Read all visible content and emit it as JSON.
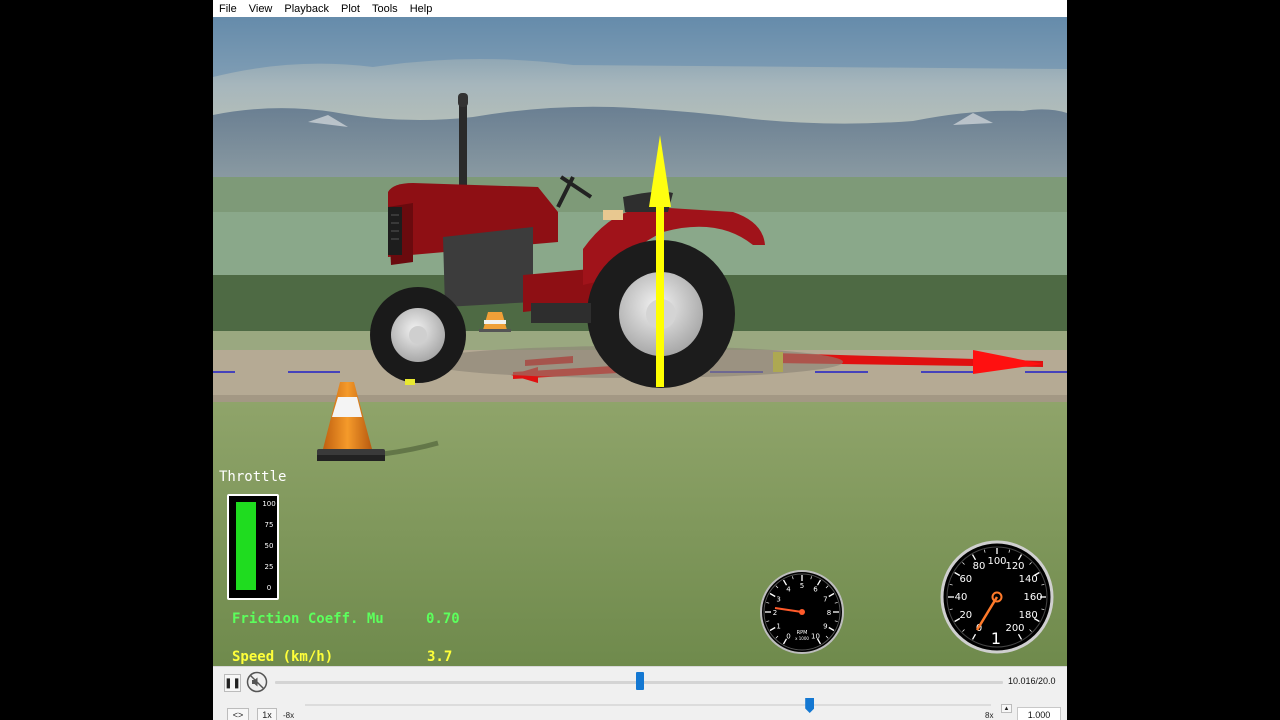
{
  "menu": {
    "items": [
      "File",
      "View",
      "Playback",
      "Plot",
      "Tools",
      "Help"
    ]
  },
  "hud": {
    "throttle": {
      "title": "Throttle",
      "ticks": [
        "100",
        "75",
        "50",
        "25",
        "0"
      ],
      "level_percent": 100,
      "fill_color": "#1fdc1f"
    },
    "friction": {
      "label": "Friction Coeff. Mu",
      "value": "0.70",
      "color": "#5cff5c"
    },
    "speed": {
      "label": "Speed (km/h)",
      "value": "3.7",
      "color": "#ffff3a"
    },
    "rpm_gauge": {
      "numbers": [
        "0",
        "1",
        "2",
        "3",
        "4",
        "5",
        "6",
        "7",
        "8",
        "9",
        "10"
      ],
      "caption_top": "RPM",
      "caption_bottom": "x 1000"
    },
    "speedometer": {
      "numbers": [
        "0",
        "20",
        "40",
        "60",
        "80",
        "100",
        "120",
        "140",
        "160",
        "180",
        "200"
      ],
      "gear": "1"
    }
  },
  "scene": {
    "force_arrow_vertical_color": "#ffff00",
    "force_arrow_horizontal_color": "#ff0000",
    "tractor_color": "#8e0f14",
    "path_line_color": "#2020c8"
  },
  "playback": {
    "pause_icon": "pause-icon",
    "mute_icon": "mute-icon",
    "time_readout": "10.016/20.0",
    "current_time": 10.016,
    "total_time": 20.0,
    "loop_label": "<>",
    "onex_label": "1x",
    "min_speed_label": "-8x",
    "max_speed_label": "8x",
    "speed_slider_fraction": 0.735,
    "speed_value": "1.000",
    "accent": "#1478d2"
  }
}
